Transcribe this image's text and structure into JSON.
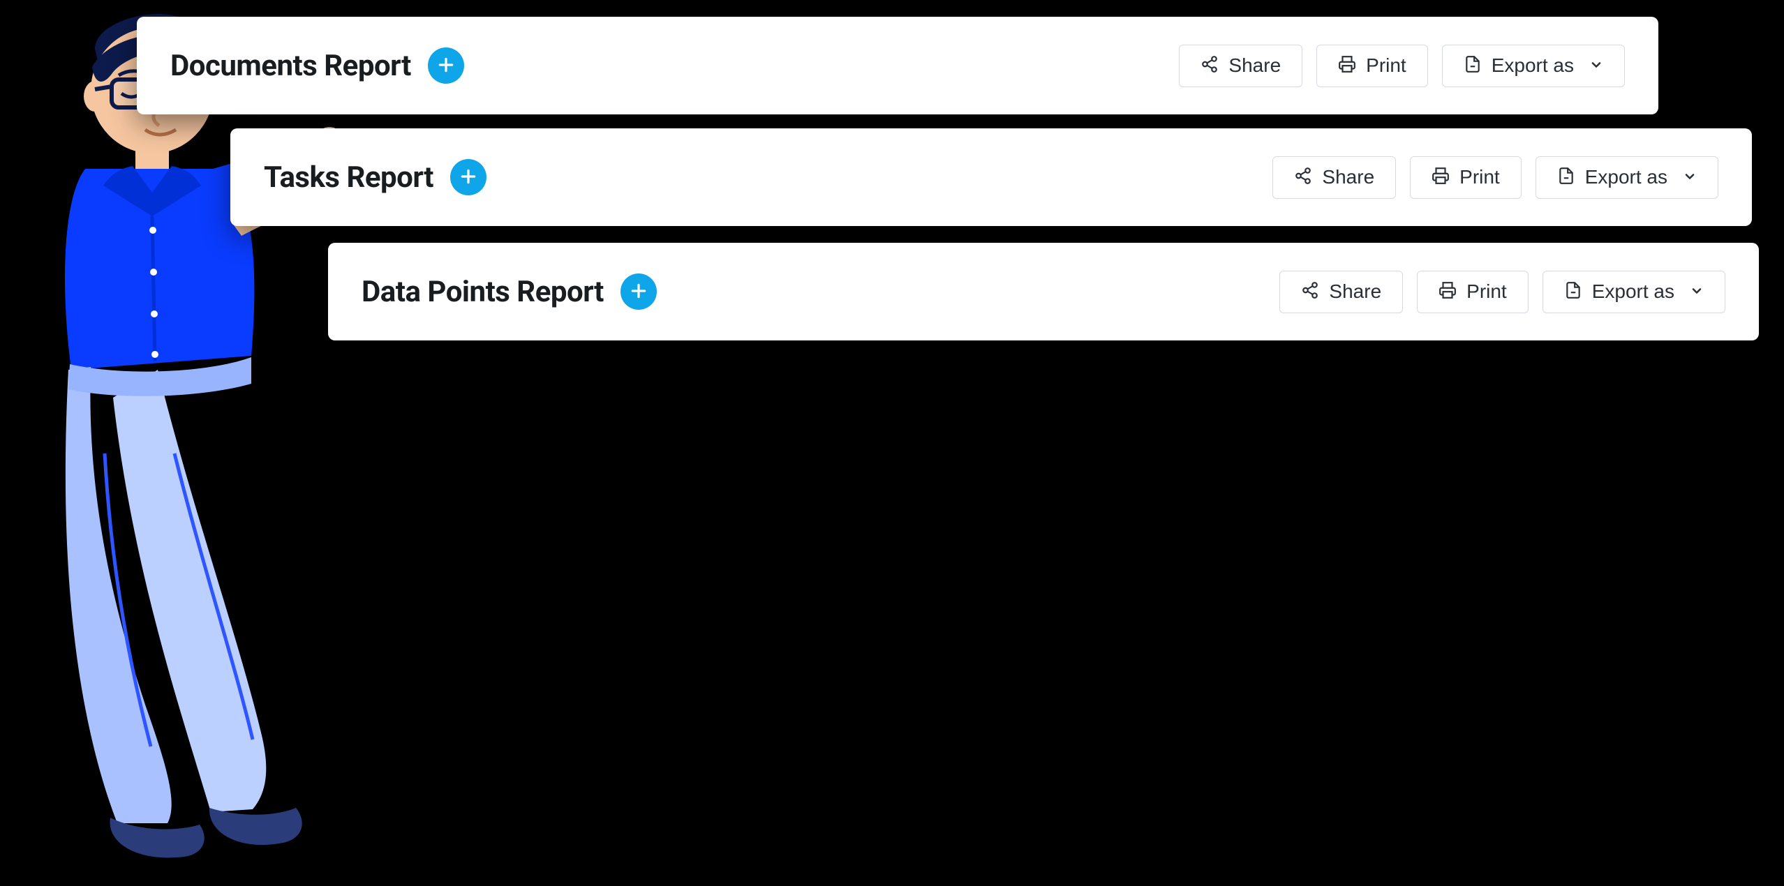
{
  "cards": [
    {
      "title": "Documents Report",
      "share": "Share",
      "print": "Print",
      "export": "Export as"
    },
    {
      "title": "Tasks Report",
      "share": "Share",
      "print": "Print",
      "export": "Export as"
    },
    {
      "title": "Data Points Report",
      "share": "Share",
      "print": "Print",
      "export": "Export as"
    }
  ],
  "icons": {
    "plus": "plus-icon",
    "share": "share-icon",
    "print": "print-icon",
    "export": "file-export-icon",
    "chev": "chevron-down-icon"
  },
  "colors": {
    "accent": "#0ea5e9",
    "text": "#1a1d1f",
    "border": "#d6dae0"
  }
}
